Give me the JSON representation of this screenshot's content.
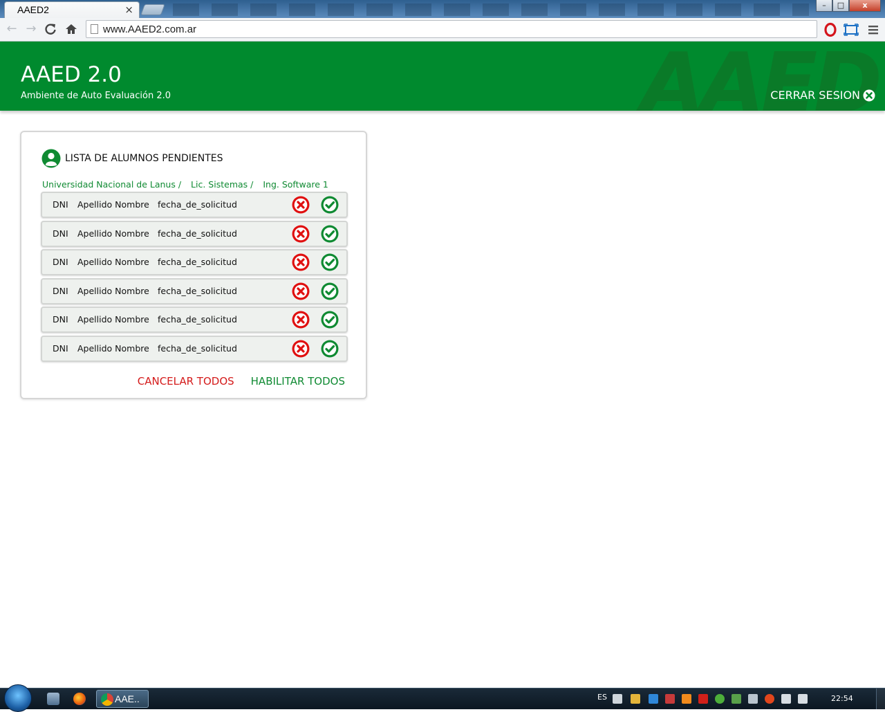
{
  "browser": {
    "tab_title": "AAED2",
    "tab_close": "×",
    "url": "www.AAED2.com.ar",
    "window_controls": {
      "minimize": "–",
      "maximize": "□",
      "close": "x"
    }
  },
  "header": {
    "title": "AAED 2.0",
    "subtitle": "Ambiente de Auto Evaluación 2.0",
    "watermark": "AAED",
    "logout_label": "CERRAR SESION"
  },
  "card": {
    "title": "LISTA DE ALUMNOS PENDIENTES",
    "breadcrumb": [
      "Universidad Nacional de Lanus /",
      "Lic. Sistemas /",
      "Ing. Software 1"
    ],
    "rows": [
      {
        "dni": "DNI",
        "name": "Apellido Nombre",
        "date": "fecha_de_solicitud"
      },
      {
        "dni": "DNI",
        "name": "Apellido Nombre",
        "date": "fecha_de_solicitud"
      },
      {
        "dni": "DNI",
        "name": "Apellido Nombre",
        "date": "fecha_de_solicitud"
      },
      {
        "dni": "DNI",
        "name": "Apellido Nombre",
        "date": "fecha_de_solicitud"
      },
      {
        "dni": "DNI",
        "name": "Apellido Nombre",
        "date": "fecha_de_solicitud"
      },
      {
        "dni": "DNI",
        "name": "Apellido Nombre",
        "date": "fecha_de_solicitud"
      }
    ],
    "cancel_all": "CANCELAR TODOS",
    "enable_all": "HABILITAR TODOS"
  },
  "taskbar": {
    "task_label": "AAE..",
    "language": "ES",
    "clock": "22:54"
  },
  "colors": {
    "brand_green": "#008a2e",
    "reject_red": "#d41a1a",
    "accept_green": "#0f8a32"
  },
  "icons": [
    "back-icon",
    "forward-icon",
    "reload-icon",
    "home-icon",
    "user-icon",
    "reject-icon",
    "accept-icon",
    "close-circle-icon"
  ]
}
